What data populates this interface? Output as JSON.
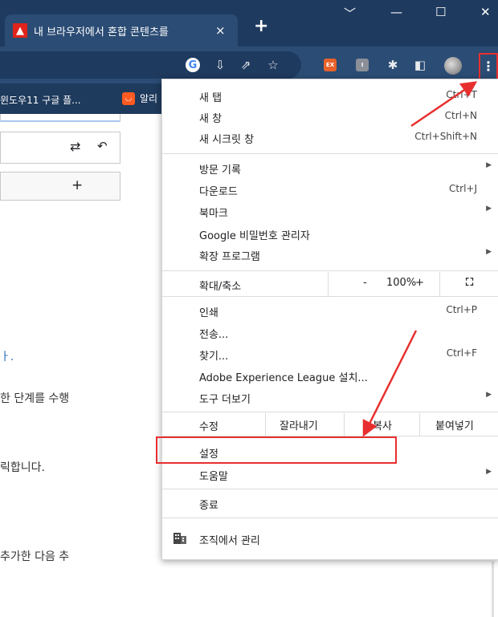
{
  "browser": {
    "tab_title": "내 브라우저에서 혼합 콘텐츠를",
    "tab_close": "×",
    "new_tab": "+",
    "window_controls": [
      "﹀",
      "—",
      "☐",
      "✕"
    ]
  },
  "bookmarks": {
    "item1": "윈도우11 구글 플...",
    "item2": "알리"
  },
  "menu": {
    "new_tab": {
      "label": "새 탭",
      "shortcut": "Ctrl+T"
    },
    "new_window": {
      "label": "새 창",
      "shortcut": "Ctrl+N"
    },
    "incognito": {
      "label": "새 시크릿 창",
      "shortcut": "Ctrl+Shift+N"
    },
    "history": {
      "label": "방문 기록"
    },
    "downloads": {
      "label": "다운로드",
      "shortcut": "Ctrl+J"
    },
    "bookmarks": {
      "label": "북마크"
    },
    "passwords": {
      "label": "Google 비밀번호 관리자"
    },
    "extensions": {
      "label": "확장 프로그램"
    },
    "zoom": {
      "label": "확대/축소",
      "minus": "-",
      "value": "100%",
      "plus": "+"
    },
    "print": {
      "label": "인쇄",
      "shortcut": "Ctrl+P"
    },
    "cast": {
      "label": "전송..."
    },
    "find": {
      "label": "찾기...",
      "shortcut": "Ctrl+F"
    },
    "install": {
      "label": "Adobe Experience League 설치..."
    },
    "more_tools": {
      "label": "도구 더보기"
    },
    "edit": {
      "label": "수정",
      "cut": "잘라내기",
      "copy": "복사",
      "paste": "붙여넣기"
    },
    "settings": {
      "label": "설정"
    },
    "help": {
      "label": "도움말"
    },
    "exit": {
      "label": "종료"
    },
    "managed": {
      "label": "조직에서 관리"
    }
  },
  "page": {
    "line1": "ㅏ.",
    "line2": "한 단계를 수행",
    "line3": "릭합니다.",
    "line4": "추가한 다음 추",
    "swap_icon": "⇄",
    "undo_icon": "↶",
    "add_icon": "+"
  },
  "colors": {
    "title_bar": "#1f3a5f",
    "toolbar": "#2b4c74",
    "annotation_red": "#e82f2f"
  }
}
